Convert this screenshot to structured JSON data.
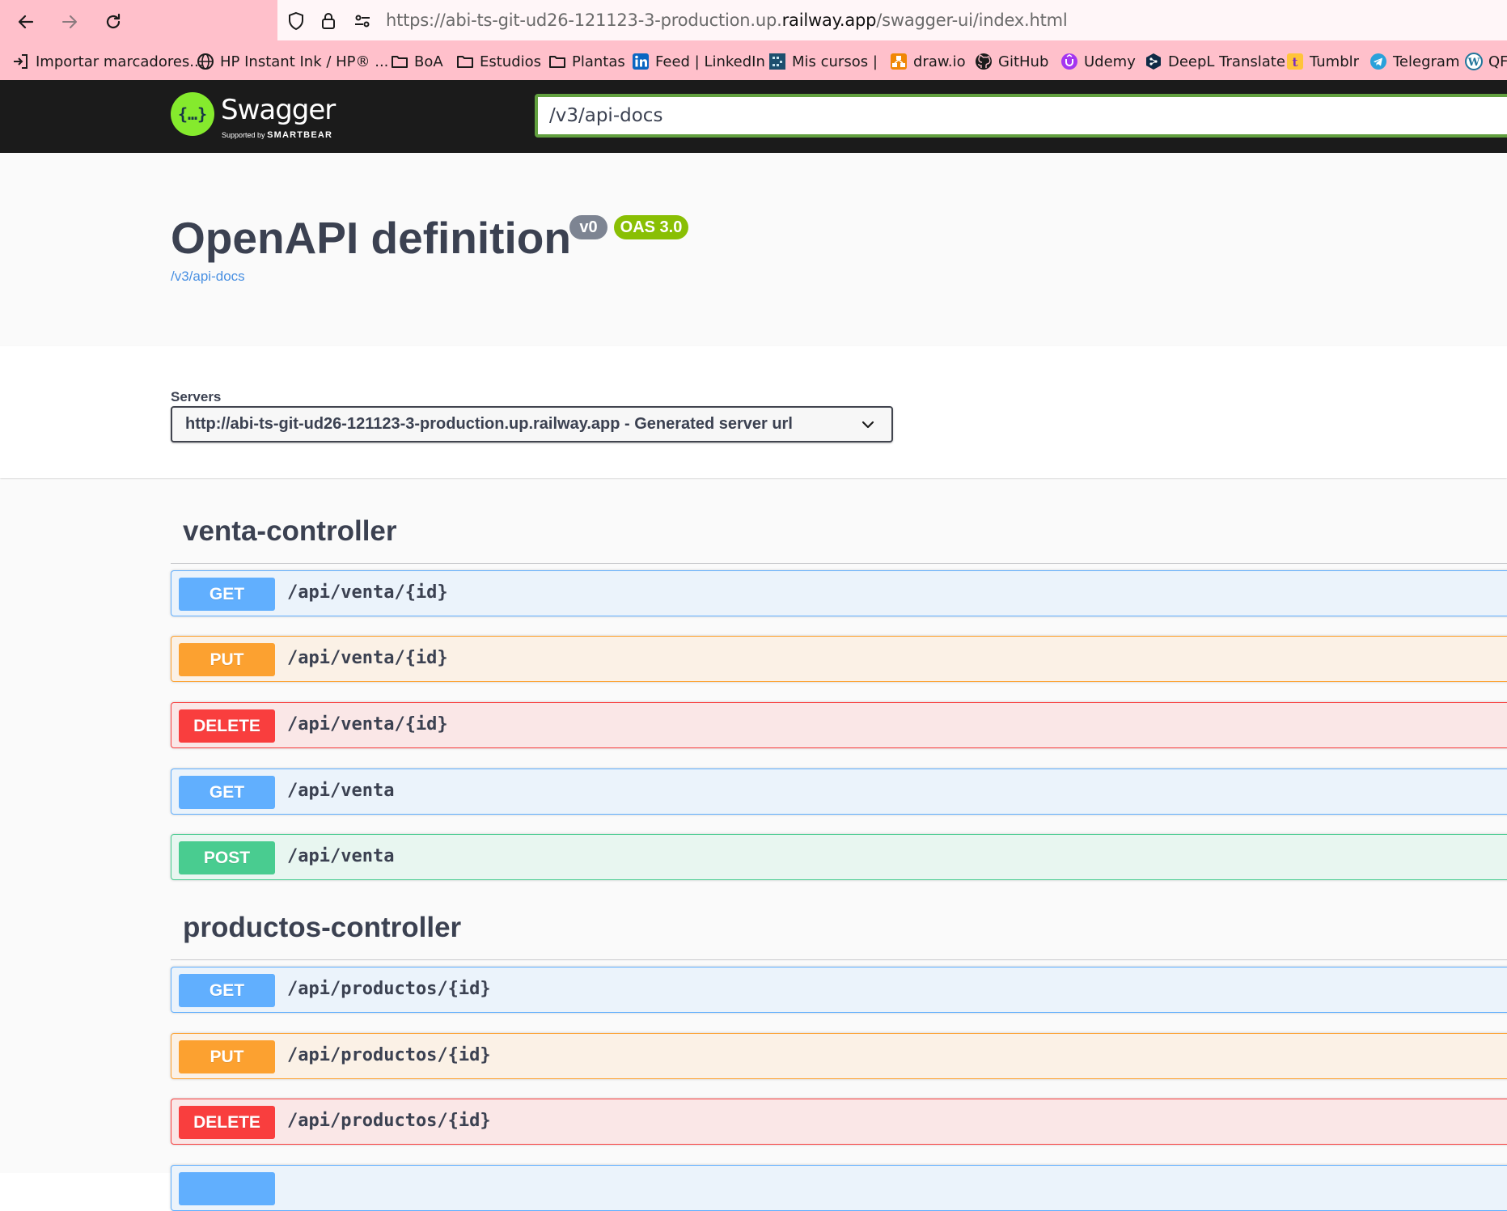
{
  "browser": {
    "url_prefix": "https://abi-ts-git-ud26-121123-3-production.up.",
    "url_domain": "railway.app",
    "url_suffix": "/swagger-ui/index.html",
    "bookmarks": [
      {
        "label": "Importar marcadores...",
        "icon": "import-icon"
      },
      {
        "label": "HP Instant Ink / HP® ...",
        "icon": "globe-icon"
      },
      {
        "label": "BoA",
        "icon": "folder-icon"
      },
      {
        "label": "Estudios",
        "icon": "folder-icon"
      },
      {
        "label": "Plantas",
        "icon": "folder-icon"
      },
      {
        "label": "Feed | LinkedIn",
        "icon": "linkedin-icon"
      },
      {
        "label": "Mis cursos |",
        "icon": "course-icon"
      },
      {
        "label": "draw.io",
        "icon": "drawio-icon"
      },
      {
        "label": "GitHub",
        "icon": "github-icon"
      },
      {
        "label": "Udemy",
        "icon": "udemy-icon"
      },
      {
        "label": "DeepL Translate",
        "icon": "deepl-icon"
      },
      {
        "label": "Tumblr",
        "icon": "tumblr-icon"
      },
      {
        "label": "Telegram",
        "icon": "telegram-icon"
      },
      {
        "label": "QF",
        "icon": "wordpress-icon"
      }
    ]
  },
  "topbar": {
    "logo_glyph": "{…}",
    "brand": "Swagger",
    "supported_by": "Supported by",
    "smartbear": "SMARTBEAR",
    "spec_url": "/v3/api-docs"
  },
  "info": {
    "title": "OpenAPI definition",
    "version": "v0",
    "oas": "OAS 3.0",
    "spec_link": "/v3/api-docs"
  },
  "servers": {
    "label": "Servers",
    "selected": "http://abi-ts-git-ud26-121123-3-production.up.railway.app - Generated server url"
  },
  "colors": {
    "get": "#61affe",
    "put": "#fca130",
    "delete": "#f93e3e",
    "post": "#49cc90",
    "topbar": "#1b1b1b",
    "swagger_green": "#85ea2d"
  },
  "sections": [
    {
      "name": "venta-controller",
      "operations": [
        {
          "method": "GET",
          "path": "/api/venta/{id}"
        },
        {
          "method": "PUT",
          "path": "/api/venta/{id}"
        },
        {
          "method": "DELETE",
          "path": "/api/venta/{id}"
        },
        {
          "method": "GET",
          "path": "/api/venta"
        },
        {
          "method": "POST",
          "path": "/api/venta"
        }
      ]
    },
    {
      "name": "productos-controller",
      "operations": [
        {
          "method": "GET",
          "path": "/api/productos/{id}"
        },
        {
          "method": "PUT",
          "path": "/api/productos/{id}"
        },
        {
          "method": "DELETE",
          "path": "/api/productos/{id}"
        }
      ]
    }
  ]
}
